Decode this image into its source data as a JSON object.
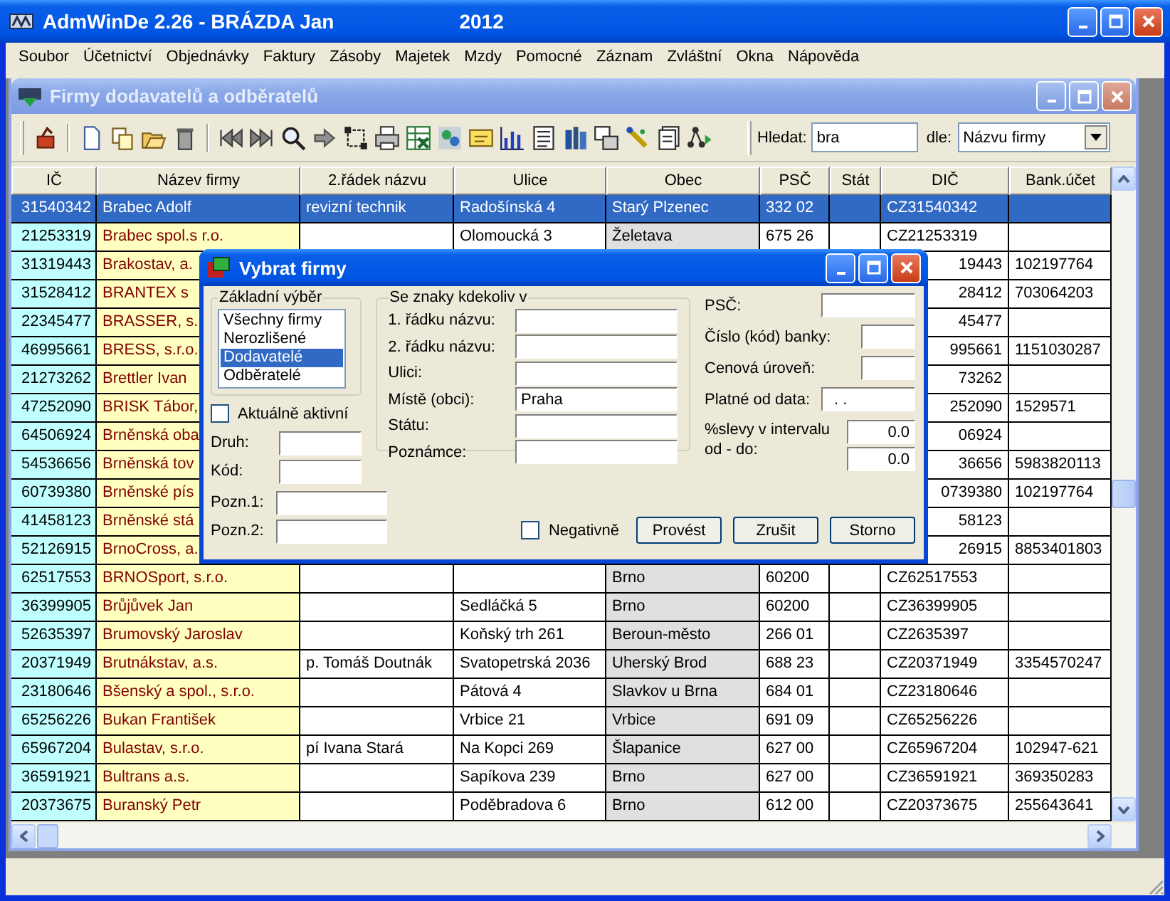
{
  "window": {
    "title": "AdmWinDe 2.26 - BRÁZDA Jan",
    "year": "2012"
  },
  "menu": [
    "Soubor",
    "Účetnictví",
    "Objednávky",
    "Faktury",
    "Zásoby",
    "Majetek",
    "Mzdy",
    "Pomocné",
    "Záznam",
    "Zvláštní",
    "Okna",
    "Nápověda"
  ],
  "child_window": {
    "title": "Firmy dodavatelů a odběratelů"
  },
  "search": {
    "label": "Hledat:",
    "value": "bra",
    "by_label": "dle:",
    "by_value": "Názvu firmy"
  },
  "table": {
    "columns": [
      "IČ",
      "Název firmy",
      "2.řádek názvu",
      "Ulice",
      "Obec",
      "PSČ",
      "Stát",
      "DIČ",
      "Bank.účet"
    ],
    "rows": [
      {
        "selected": true,
        "ic": "31540342",
        "name": "Brabec Adolf",
        "line2": "revizní technik",
        "street": "Radošínská 4",
        "city": "Starý Plzenec",
        "psc": "332 02",
        "dic": "CZ31540342"
      },
      {
        "selected": false,
        "ic": "21253319",
        "name": "Brabec spol.s r.o.",
        "street": "Olomoucká 3",
        "city": "Želetava",
        "psc": "675 26",
        "dic": "CZ21253319"
      },
      {
        "selected": false,
        "covered": true,
        "ic": "31319443",
        "name": "Brakostav, a.",
        "dic": "19443",
        "bank": "102197764"
      },
      {
        "selected": false,
        "covered": true,
        "ic": "31528412",
        "name": "BRANTEX s",
        "dic": "28412",
        "bank": "703064203"
      },
      {
        "selected": false,
        "covered": true,
        "ic": "22345477",
        "name": "BRASSER, s.",
        "dic": "45477"
      },
      {
        "selected": false,
        "covered": true,
        "ic": "46995661",
        "name": "BRESS, s.r.o.",
        "dic": "995661",
        "bank": "1151030287"
      },
      {
        "selected": false,
        "covered": true,
        "ic": "21273262",
        "name": "Brettler Ivan",
        "dic": "73262"
      },
      {
        "selected": false,
        "covered": true,
        "ic": "47252090",
        "name": "BRISK Tábor,",
        "dic": "252090",
        "bank": "1529571"
      },
      {
        "selected": false,
        "covered": true,
        "ic": "64506924",
        "name": "Brněnská oba",
        "dic": "06924"
      },
      {
        "selected": false,
        "covered": true,
        "ic": "54536656",
        "name": "Brněnská tov",
        "dic": "36656",
        "bank": "5983820113"
      },
      {
        "selected": false,
        "covered": true,
        "ic": "60739380",
        "name": "Brněnské pís",
        "dic": "0739380",
        "bank": "102197764"
      },
      {
        "selected": false,
        "covered": true,
        "ic": "41458123",
        "name": "Brněnské stá",
        "dic": "58123"
      },
      {
        "selected": false,
        "covered": true,
        "ic": "52126915",
        "name": "BrnoCross, a.",
        "dic": "26915",
        "bank": "8853401803"
      },
      {
        "selected": false,
        "ic": "62517553",
        "name": "BRNOSport, s.r.o.",
        "city": "Brno",
        "psc": "60200",
        "dic": "CZ62517553"
      },
      {
        "selected": false,
        "ic": "36399905",
        "name": "Brůjůvek Jan",
        "street": "Sedláčká 5",
        "city": "Brno",
        "psc": "60200",
        "dic": "CZ36399905"
      },
      {
        "selected": false,
        "ic": "52635397",
        "name": "Brumovský Jaroslav",
        "street": "Koňský trh 261",
        "city": "Beroun-město",
        "psc": "266 01",
        "dic": "CZ2635397"
      },
      {
        "selected": false,
        "ic": "20371949",
        "name": "Brutnákstav, a.s.",
        "line2": "p. Tomáš Doutnák",
        "street": "Svatopetrská 2036",
        "city": "Uherský Brod",
        "psc": "688 23",
        "dic": "CZ20371949",
        "bank": "3354570247"
      },
      {
        "selected": false,
        "ic": "23180646",
        "name": "Bšenský a spol., s.r.o.",
        "street": "Pátová 4",
        "city": "Slavkov u Brna",
        "psc": "684 01",
        "dic": "CZ23180646"
      },
      {
        "selected": false,
        "ic": "65256226",
        "name": "Bukan František",
        "street": "Vrbice 21",
        "city": "Vrbice",
        "psc": "691 09",
        "dic": "CZ65256226"
      },
      {
        "selected": false,
        "ic": "65967204",
        "name": "Bulastav, s.r.o.",
        "line2": "pí Ivana Stará",
        "street": "Na Kopci 269",
        "city": "Šlapanice",
        "psc": "627 00",
        "dic": "CZ65967204",
        "bank": "102947-621"
      },
      {
        "selected": false,
        "ic": "36591921",
        "name": "Bultrans a.s.",
        "street": "Sapíkova 239",
        "city": "Brno",
        "psc": "627 00",
        "dic": "CZ36591921",
        "bank": "369350283"
      },
      {
        "selected": false,
        "ic": "20373675",
        "name": "Buranský Petr",
        "street": "Poděbradova 6",
        "city": "Brno",
        "psc": "612 00",
        "dic": "CZ20373675",
        "bank": "255643641"
      }
    ]
  },
  "dialog": {
    "title": "Vybrat firmy",
    "basic_group": {
      "label": "Základní výběr",
      "items": [
        {
          "label": "Všechny firmy",
          "selected": false
        },
        {
          "label": "Nerozlišené",
          "selected": false
        },
        {
          "label": "Dodavatelé",
          "selected": true
        },
        {
          "label": "Odběratelé",
          "selected": false
        }
      ]
    },
    "active_checkbox": {
      "label": "Aktuálně aktivní",
      "checked": false
    },
    "left_fields": [
      {
        "label": "Druh:"
      },
      {
        "label": "Kód:"
      }
    ],
    "note_fields": [
      {
        "label": "Pozn.1:"
      },
      {
        "label": "Pozn.2:"
      }
    ],
    "search_group": {
      "label": "Se znaky kdekoliv v",
      "fields": [
        {
          "label": "1. řádku názvu:"
        },
        {
          "label": "2. řádku názvu:"
        },
        {
          "label": "Ulici:"
        },
        {
          "label": "Místě (obci):",
          "value": "Praha"
        },
        {
          "label": "Státu:"
        },
        {
          "label": "Poznámce:"
        }
      ]
    },
    "right_fields": [
      {
        "label": "PSČ:"
      },
      {
        "label": "Číslo (kód) banky:"
      },
      {
        "label": "Cenová úroveň:"
      },
      {
        "label": "Platné od data:",
        "value": ". ."
      }
    ],
    "discount": {
      "label": "%slevy v intervalu od - do:",
      "from": "0.0",
      "to": "0.0"
    },
    "negative_checkbox": {
      "label": "Negativně",
      "checked": false
    },
    "buttons": [
      "Provést",
      "Zrušit",
      "Storno"
    ]
  }
}
